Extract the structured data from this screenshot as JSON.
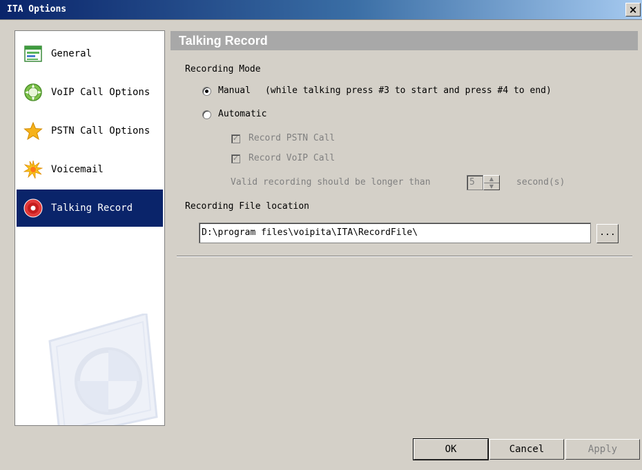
{
  "window": {
    "title": "ITA Options",
    "close_glyph": "×"
  },
  "sidebar": {
    "items": [
      {
        "label": "General",
        "icon": "general-icon",
        "active": false
      },
      {
        "label": "VoIP Call Options",
        "icon": "voip-call-icon",
        "active": false
      },
      {
        "label": "PSTN Call Options",
        "icon": "pstn-star-icon",
        "active": false
      },
      {
        "label": "Voicemail",
        "icon": "voicemail-burst-icon",
        "active": false
      },
      {
        "label": "Talking Record",
        "icon": "record-icon",
        "active": true
      }
    ]
  },
  "panel": {
    "header": "Talking Record",
    "recording_mode_label": "Recording Mode",
    "manual": {
      "label": "Manual",
      "hint": "(while talking press #3 to start and press #4 to end)",
      "checked": true
    },
    "automatic": {
      "label": "Automatic",
      "checked": false
    },
    "record_pstn": {
      "label": "Record PSTN Call",
      "checked": true,
      "enabled": false
    },
    "record_voip": {
      "label": "Record VoIP Call",
      "checked": true,
      "enabled": false
    },
    "valid_recording": {
      "prefix": "Valid recording should be longer than",
      "value": "5",
      "suffix": "second(s)",
      "enabled": false
    },
    "file_location_label": "Recording File location",
    "file_location_value": "D:\\program files\\voipita\\ITA\\RecordFile\\",
    "browse_label": "..."
  },
  "buttons": {
    "ok": "OK",
    "cancel": "Cancel",
    "apply": "Apply"
  },
  "colors": {
    "active_item": "#0a246a",
    "dialog_bg": "#d4d0c8",
    "header_bg": "#a8a8a8"
  }
}
